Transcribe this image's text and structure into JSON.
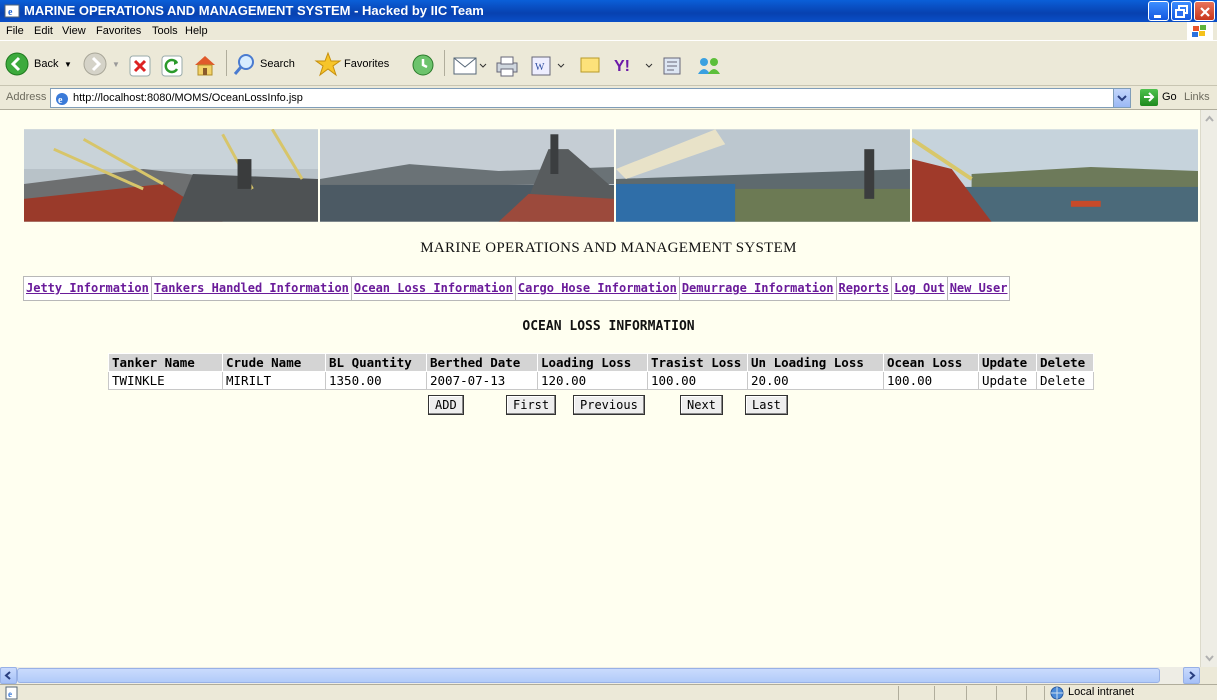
{
  "window": {
    "title": "MARINE OPERATIONS AND MANAGEMENT SYSTEM - Hacked by IIC Team"
  },
  "menu": [
    "File",
    "Edit",
    "View",
    "Favorites",
    "Tools",
    "Help"
  ],
  "toolbar": {
    "back_label": "Back",
    "search_label": "Search",
    "favorites_label": "Favorites"
  },
  "address": {
    "label": "Address",
    "url": "http://localhost:8080/MOMS/OceanLossInfo.jsp",
    "go_label": "Go",
    "links_label": "Links"
  },
  "page": {
    "site_title": "MARINE OPERATIONS AND MANAGEMENT SYSTEM",
    "nav": [
      "Jetty Information",
      "Tankers Handled Information",
      "Ocean Loss Information",
      "Cargo Hose Information",
      "Demurrage Information",
      "Reports",
      "Log Out",
      "New User"
    ],
    "section_title": "OCEAN LOSS INFORMATION",
    "table": {
      "headers": [
        "Tanker Name",
        "Crude Name",
        "BL Quantity",
        "Berthed Date",
        "Loading Loss",
        "Trasist Loss",
        "Un Loading Loss",
        "Ocean Loss",
        "Update",
        "Delete"
      ],
      "rows": [
        [
          "TWINKLE",
          "MIRILT",
          "1350.00",
          "2007-07-13",
          "120.00",
          "100.00",
          "20.00",
          "100.00",
          "Update",
          "Delete"
        ]
      ]
    },
    "buttons": {
      "add": "ADD",
      "first": "First",
      "previous": "Previous",
      "next": "Next",
      "last": "Last"
    }
  },
  "status": {
    "zone": "Local intranet"
  }
}
